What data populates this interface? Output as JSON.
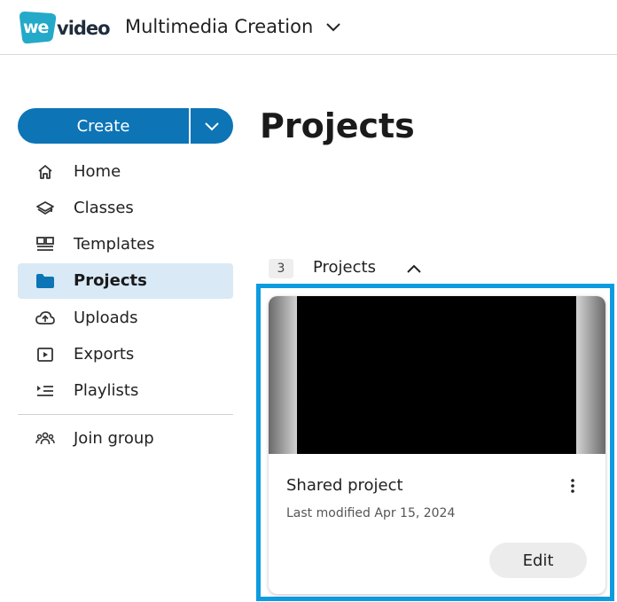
{
  "header": {
    "logo_we": "we",
    "logo_video": "video",
    "workspace": "Multimedia Creation",
    "brand_color": "#24a9c9"
  },
  "sidebar": {
    "create_label": "Create",
    "items": [
      {
        "label": "Home",
        "icon": "home-icon",
        "active": false
      },
      {
        "label": "Classes",
        "icon": "layers-icon",
        "active": false
      },
      {
        "label": "Templates",
        "icon": "templates-icon",
        "active": false
      },
      {
        "label": "Projects",
        "icon": "folder-icon",
        "active": true
      },
      {
        "label": "Uploads",
        "icon": "cloud-upload-icon",
        "active": false
      },
      {
        "label": "Exports",
        "icon": "play-box-icon",
        "active": false
      },
      {
        "label": "Playlists",
        "icon": "playlist-icon",
        "active": false
      }
    ],
    "join_group": {
      "label": "Join group",
      "icon": "group-icon"
    },
    "accent_color": "#0d74b6"
  },
  "main": {
    "title": "Projects",
    "group": {
      "count": "3",
      "label": "Projects"
    },
    "cards": [
      {
        "title": "Shared project",
        "meta": "Last modified Apr 15, 2024",
        "edit_label": "Edit"
      }
    ],
    "highlight_color": "#0d9be0"
  }
}
